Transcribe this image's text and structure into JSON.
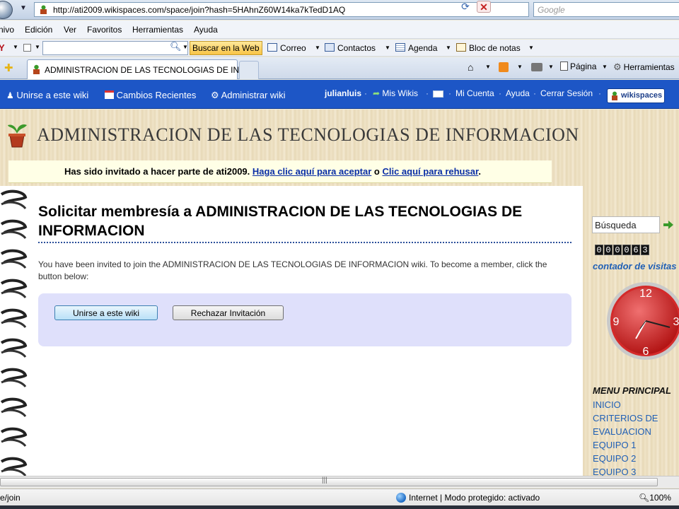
{
  "browser": {
    "url": "http://ati2009.wikispaces.com/space/join?hash=5HAhnZ60W14ka7kTedD1AQ",
    "search_placeholder": "Google",
    "menu": [
      "nivo",
      "Edición",
      "Ver",
      "Favoritos",
      "Herramientas",
      "Ayuda"
    ],
    "toolbar": {
      "search_button": "Buscar en la Web",
      "items": [
        "Correo",
        "Contactos",
        "Agenda",
        "Bloc de notas"
      ]
    },
    "tab_title": "ADMINISTRACION DE LAS TECNOLOGIAS DE INF...",
    "commands": [
      "Página",
      "Herramientas"
    ]
  },
  "wikibar": {
    "join": "Unirse a este wiki",
    "recent": "Cambios Recientes",
    "admin": "Administrar wiki",
    "user": "julianluis",
    "my_wikis": "Mis Wikis",
    "account": "Mi Cuenta",
    "help": "Ayuda",
    "logout": "Cerrar Sesión",
    "logo": "wikispaces"
  },
  "site": {
    "title": "ADMINISTRACION DE LAS TECNOLOGIAS DE INFORMACION"
  },
  "invite": {
    "text": "Has sido invitado a hacer parte de ati2009.",
    "accept_link": "Haga clic aquí para aceptar",
    "connector": "o",
    "reject_link": "Clic aquí para rehusar",
    "end": "."
  },
  "main": {
    "heading_prefix": "Solicitar membresía a",
    "heading_name": "ADMINISTRACION DE LAS TECNOLOGIAS DE INFORMACION",
    "intro": "You have been invited to join the ADMINISTRACION DE LAS TECNOLOGIAS DE INFORMACION wiki. To become a member, click the button below:",
    "join_button": "Unirse a este wiki",
    "reject_button": "Rechazar Invitación"
  },
  "sidebar": {
    "search_value": "Búsqueda",
    "counter_digits": [
      "0",
      "0",
      "0",
      "0",
      "6",
      "3"
    ],
    "counter_label": "contador de visitas",
    "clock_numbers": [
      "12",
      "3",
      "6",
      "9"
    ],
    "menu_heading": "MENU PRINCIPAL",
    "menu_items": [
      "INICIO",
      "CRITERIOS DE",
      "EVALUACION",
      "EQUIPO 1",
      "EQUIPO 2",
      "EQUIPO 3"
    ]
  },
  "status": {
    "left": "e/join",
    "zone": "Internet | Modo protegido: activado",
    "zoom": "100%"
  },
  "colors": {
    "wikibar": "#1d56c6",
    "link": "#0b2fa6",
    "sidebar_link": "#1f5fb5",
    "panel": "#dfe0fb"
  }
}
